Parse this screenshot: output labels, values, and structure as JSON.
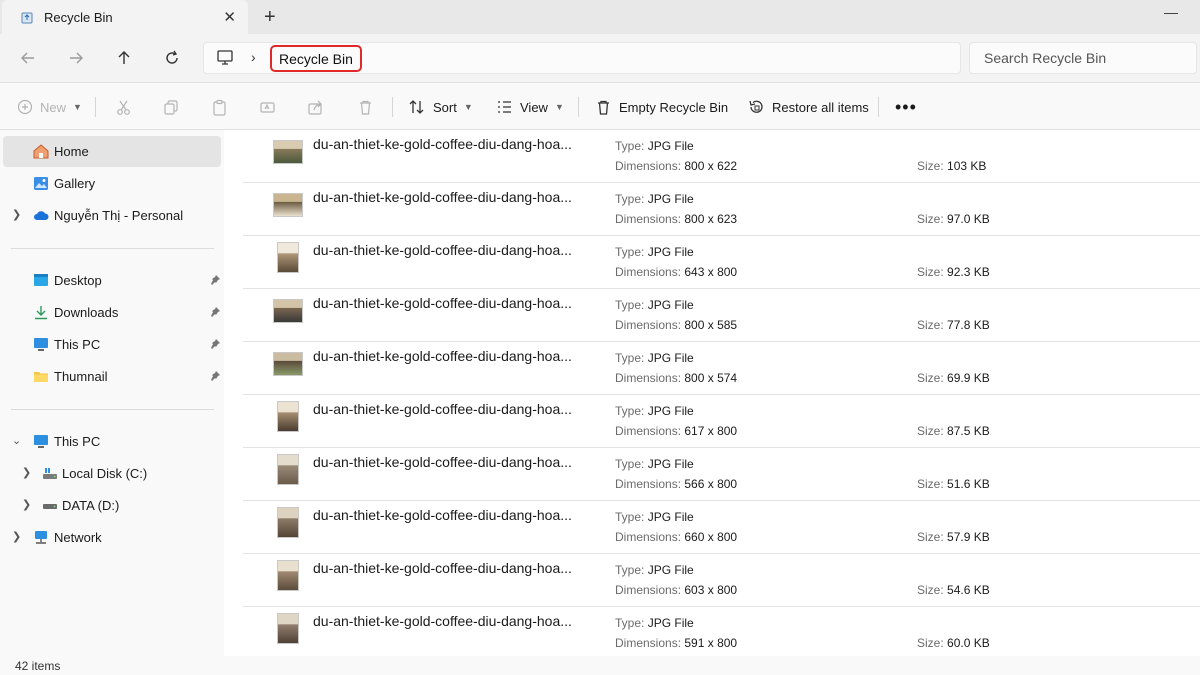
{
  "tab": {
    "title": "Recycle Bin"
  },
  "address": {
    "crumb": "Recycle Bin",
    "search_placeholder": "Search Recycle Bin"
  },
  "toolbar": {
    "new_label": "New",
    "sort_label": "Sort",
    "view_label": "View",
    "empty_label": "Empty Recycle Bin",
    "restore_label": "Restore all items"
  },
  "sidebar": {
    "home": "Home",
    "gallery": "Gallery",
    "personal": "Nguyễn Thị - Personal",
    "quick": [
      "Desktop",
      "Downloads",
      "This PC",
      "Thumnail"
    ],
    "thispc": "This PC",
    "localdisk": "Local Disk (C:)",
    "data": "DATA (D:)",
    "network": "Network"
  },
  "labels": {
    "type": "Type:",
    "dimensions": "Dimensions:",
    "size": "Size:"
  },
  "files": [
    {
      "name": "du-an-thiet-ke-gold-coffee-diu-dang-hoa...",
      "type": "JPG File",
      "dimensions": "800 x 622",
      "size": "103 KB"
    },
    {
      "name": "du-an-thiet-ke-gold-coffee-diu-dang-hoa...",
      "type": "JPG File",
      "dimensions": "800 x 623",
      "size": "97.0 KB"
    },
    {
      "name": "du-an-thiet-ke-gold-coffee-diu-dang-hoa...",
      "type": "JPG File",
      "dimensions": "643 x 800",
      "size": "92.3 KB"
    },
    {
      "name": "du-an-thiet-ke-gold-coffee-diu-dang-hoa...",
      "type": "JPG File",
      "dimensions": "800 x 585",
      "size": "77.8 KB"
    },
    {
      "name": "du-an-thiet-ke-gold-coffee-diu-dang-hoa...",
      "type": "JPG File",
      "dimensions": "800 x 574",
      "size": "69.9 KB"
    },
    {
      "name": "du-an-thiet-ke-gold-coffee-diu-dang-hoa...",
      "type": "JPG File",
      "dimensions": "617 x 800",
      "size": "87.5 KB"
    },
    {
      "name": "du-an-thiet-ke-gold-coffee-diu-dang-hoa...",
      "type": "JPG File",
      "dimensions": "566 x 800",
      "size": "51.6 KB"
    },
    {
      "name": "du-an-thiet-ke-gold-coffee-diu-dang-hoa...",
      "type": "JPG File",
      "dimensions": "660 x 800",
      "size": "57.9 KB"
    },
    {
      "name": "du-an-thiet-ke-gold-coffee-diu-dang-hoa...",
      "type": "JPG File",
      "dimensions": "603 x 800",
      "size": "54.6 KB"
    },
    {
      "name": "du-an-thiet-ke-gold-coffee-diu-dang-hoa...",
      "type": "JPG File",
      "dimensions": "591 x 800",
      "size": "60.0 KB"
    }
  ],
  "status": {
    "count": "42 items"
  }
}
